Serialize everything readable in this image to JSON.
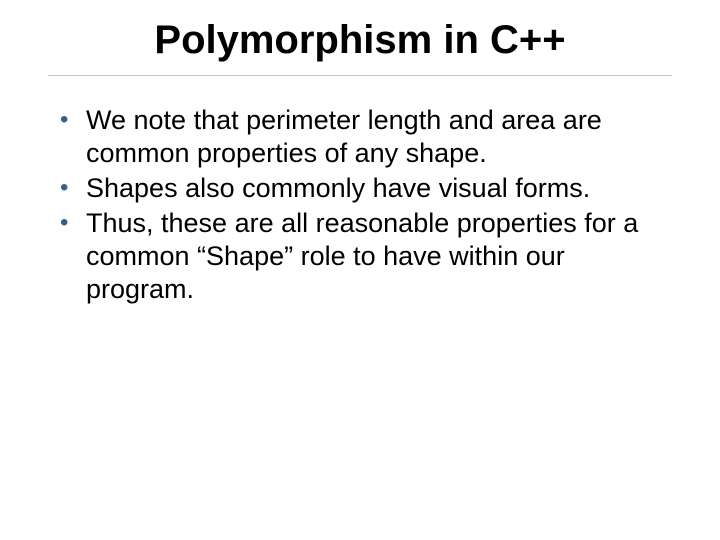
{
  "title": "Polymorphism in C++",
  "bullets": [
    "We note that perimeter length and area are common properties of any shape.",
    "Shapes also commonly have visual forms.",
    "Thus, these are all reasonable properties for a common “Shape” role to have within our program."
  ]
}
